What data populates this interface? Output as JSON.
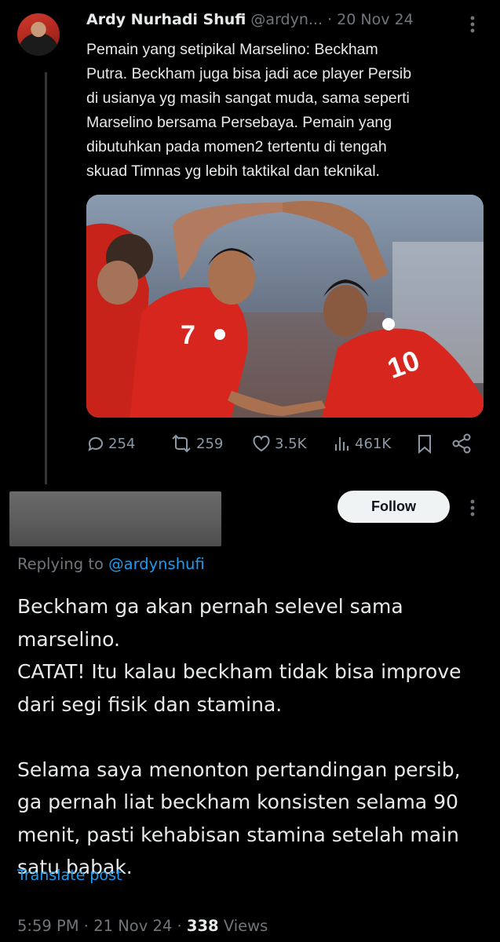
{
  "original_post": {
    "author_name": "Ardy Nurhadi Shufi",
    "handle": "@ardyn...",
    "date": "20 Nov 24",
    "separator": "·",
    "text": "Pemain yang setipikal Marselino: Beckham\nPutra. Beckham juga bisa jadi ace player Persib\ndi usianya yg masih sangat muda, sama seperti\nMarselino bersama Persebaya. Pemain yang\ndibutuhkan pada momen2 tertentu di tengah\nskuad Timnas yg lebih taktikal dan teknikal.",
    "stats": {
      "replies": "254",
      "reposts": "259",
      "likes": "3.5K",
      "views": "461K"
    }
  },
  "reply_post": {
    "follow_label": "Follow",
    "replying_prefix": "Replying to",
    "replying_to": "@ardynshufi",
    "text": "Beckham ga akan pernah selevel sama\nmarselino.\nCATAT! Itu kalau beckham tidak bisa improve\ndari segi fisik dan stamina.\n\nSelama saya menonton pertandingan persib,\nga pernah liat beckham konsisten selama 90\nmenit, pasti kehabisan stamina setelah main\nsatu babak.",
    "translate_label": "Translate post",
    "time": "5:59 PM",
    "date": "21 Nov 24",
    "views_count": "338",
    "views_label": "Views",
    "separator": "·"
  },
  "colors": {
    "background": "#000000",
    "text": "#e7e9ea",
    "muted": "#71767b",
    "accent": "#1d9bf0",
    "jersey_red": "#d6261e"
  }
}
